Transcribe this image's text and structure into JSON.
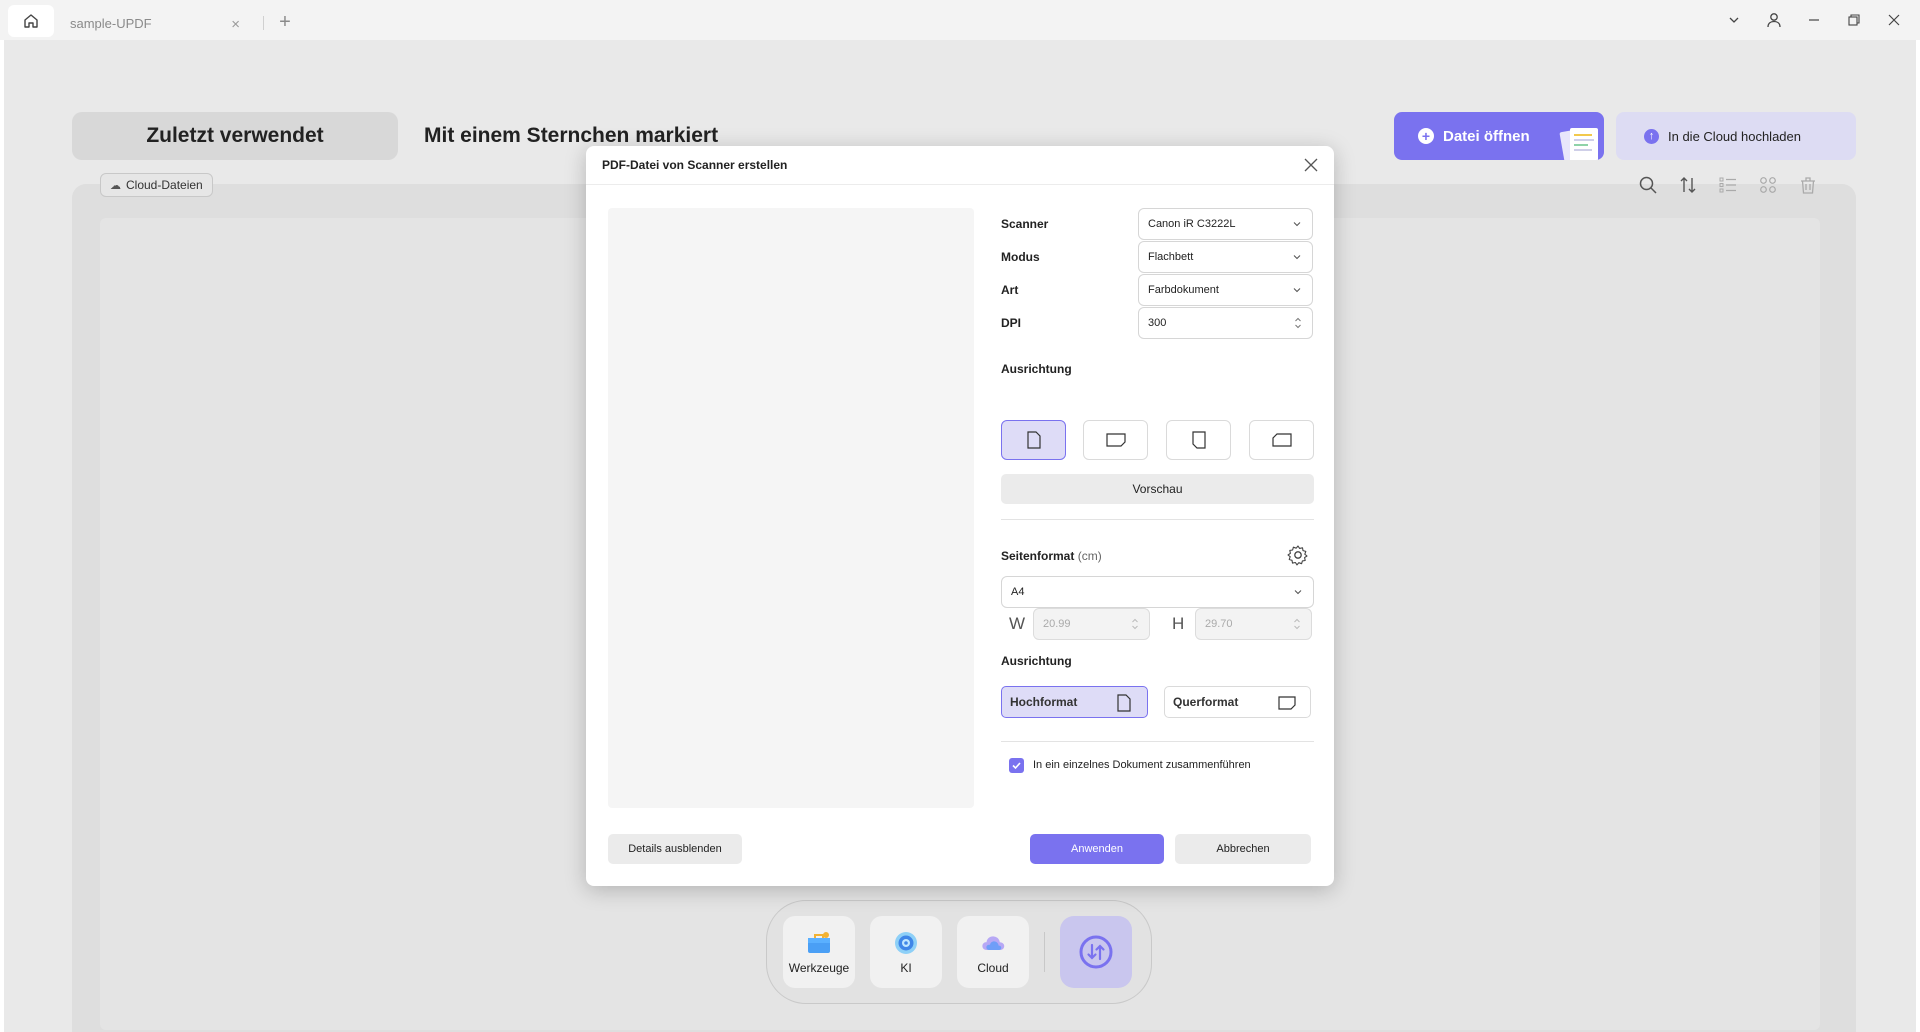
{
  "titlebar": {
    "tab_label": "sample-UPDF",
    "tab_close": "×",
    "new_tab": "+"
  },
  "header": {
    "recent_label": "Zuletzt verwendet",
    "starred_label": "Mit einem Sternchen markiert",
    "open_file_label": "Datei öffnen",
    "cloud_upload_label": "In die Cloud hochladen"
  },
  "content": {
    "cloud_chip_label": "Cloud-Dateien"
  },
  "dialog": {
    "title": "PDF-Datei von Scanner erstellen",
    "fields": {
      "scanner_label": "Scanner",
      "scanner_value": "Canon iR C3222L",
      "mode_label": "Modus",
      "mode_value": "Flachbett",
      "type_label": "Art",
      "type_value": "Farbdokument",
      "dpi_label": "DPI",
      "dpi_value": "300"
    },
    "orientation_label": "Ausrichtung",
    "preview_button": "Vorschau",
    "page_format_label": "Seitenformat",
    "page_format_unit": "(cm)",
    "page_size_value": "A4",
    "width_label": "W",
    "width_value": "20.99",
    "height_label": "H",
    "height_value": "29.70",
    "orientation2_label": "Ausrichtung",
    "portrait_label": "Hochformat",
    "landscape_label": "Querformat",
    "merge_checked": true,
    "merge_label": "In ein einzelnes Dokument zusammenführen",
    "details_button": "Details ausblenden",
    "apply_button": "Anwenden",
    "cancel_button": "Abbrechen"
  },
  "dock": {
    "items": [
      {
        "label": "Werkzeuge",
        "icon": "toolbox-icon"
      },
      {
        "label": "KI",
        "icon": "ai-icon"
      },
      {
        "label": "Cloud",
        "icon": "cloud-icon"
      }
    ]
  },
  "colors": {
    "accent": "#7a72ef",
    "accent_light": "#dedcf7"
  }
}
